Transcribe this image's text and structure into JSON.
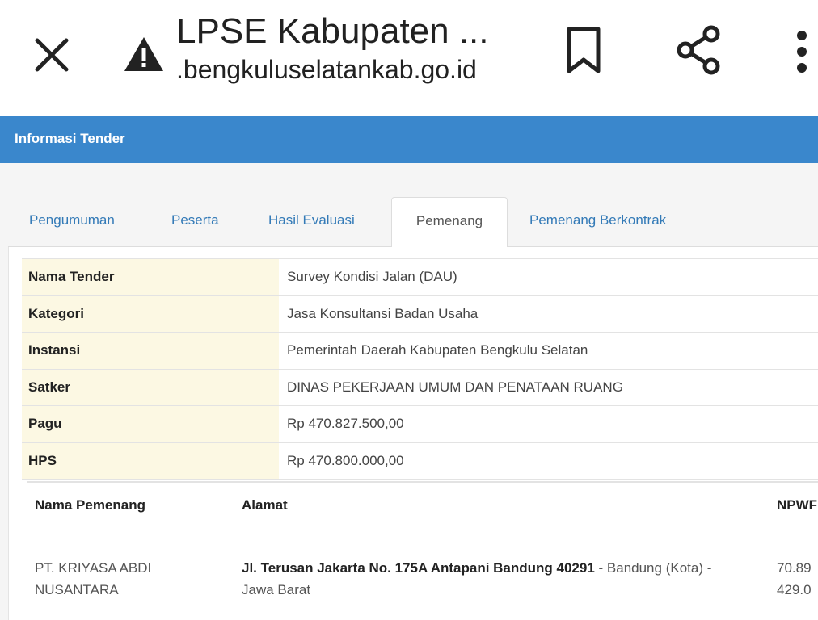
{
  "browser": {
    "title": "LPSE Kabupaten ...",
    "domain": ".bengkuluselatankab.go.id",
    "icons": [
      "close-icon",
      "warning-icon",
      "bookmark-icon",
      "share-icon",
      "more-vert-icon"
    ]
  },
  "panel": {
    "title": "Informasi Tender",
    "header_color": "#3a87cc"
  },
  "tabs": [
    {
      "label": "Pengumuman",
      "active": false
    },
    {
      "label": "Peserta",
      "active": false
    },
    {
      "label": "Hasil Evaluasi",
      "active": false
    },
    {
      "label": "Pemenang",
      "active": true
    },
    {
      "label": "Pemenang Berkontrak",
      "active": false
    }
  ],
  "info": [
    {
      "label": "Nama Tender",
      "value": "Survey Kondisi Jalan (DAU)"
    },
    {
      "label": "Kategori",
      "value": "Jasa Konsultansi Badan Usaha"
    },
    {
      "label": "Instansi",
      "value": "Pemerintah Daerah Kabupaten Bengkulu Selatan"
    },
    {
      "label": "Satker",
      "value": "DINAS PEKERJAAN UMUM DAN PENATAAN RUANG"
    },
    {
      "label": "Pagu",
      "value": "Rp 470.827.500,00"
    },
    {
      "label": "HPS",
      "value": "Rp 470.800.000,00"
    }
  ],
  "winners": {
    "headers": {
      "name": "Nama Pemenang",
      "address": "Alamat",
      "npwp": "NPWF"
    },
    "rows": [
      {
        "name_line1": "PT. KRIYASA ABDI",
        "name_line2": "NUSANTARA",
        "address_bold": "Jl. Terusan Jakarta No. 175A Antapani Bandung 40291",
        "address_rest": " - Bandung (Kota) -",
        "address_line2": "Jawa Barat",
        "npwp_line1": "70.89",
        "npwp_line2": "429.0"
      }
    ]
  }
}
